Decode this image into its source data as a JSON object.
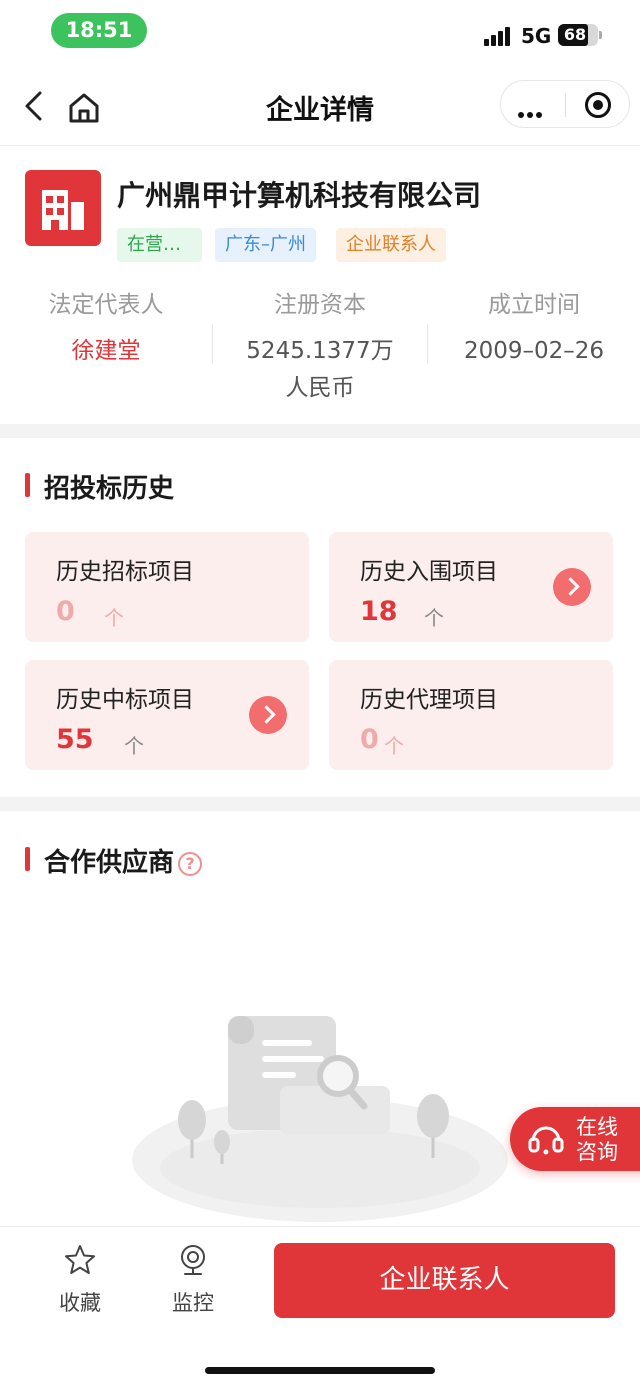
{
  "status_bar": {
    "time": "18:51",
    "network": "5G",
    "battery": "68"
  },
  "nav": {
    "title": "企业详情",
    "icons": [
      "back-icon",
      "home-icon",
      "more-icon",
      "target-icon"
    ]
  },
  "company": {
    "name": "广州鼎甲计算机科技有限公司",
    "tags": [
      "在营…",
      "广东–广州",
      "企业联系人"
    ],
    "legal_rep_label": "法定代表人",
    "legal_rep": "徐建堂",
    "capital_label": "注册资本",
    "capital_line1": "5245.1377万",
    "capital_line2": "人民币",
    "founded_label": "成立时间",
    "founded": "2009–02–26"
  },
  "bidding": {
    "title": "招投标历史",
    "cards": [
      {
        "label": "历史招标项目",
        "count": "0",
        "unit": "个"
      },
      {
        "label": "历史入围项目",
        "count": "18",
        "unit": "个"
      },
      {
        "label": "历史中标项目",
        "count": "55",
        "unit": "个"
      },
      {
        "label": "历史代理项目",
        "count": "0",
        "unit": "个"
      }
    ]
  },
  "suppliers": {
    "title": "合作供应商",
    "help_icon": "question-icon"
  },
  "consult": {
    "line1": "在线",
    "line2": "咨询"
  },
  "bottom": {
    "favorite": "收藏",
    "monitor": "监控",
    "contact_button": "企业联系人"
  },
  "colors": {
    "brand_red": "#e0363a",
    "status_green": "#3cc35e",
    "card_bg": "#fdeeee"
  }
}
